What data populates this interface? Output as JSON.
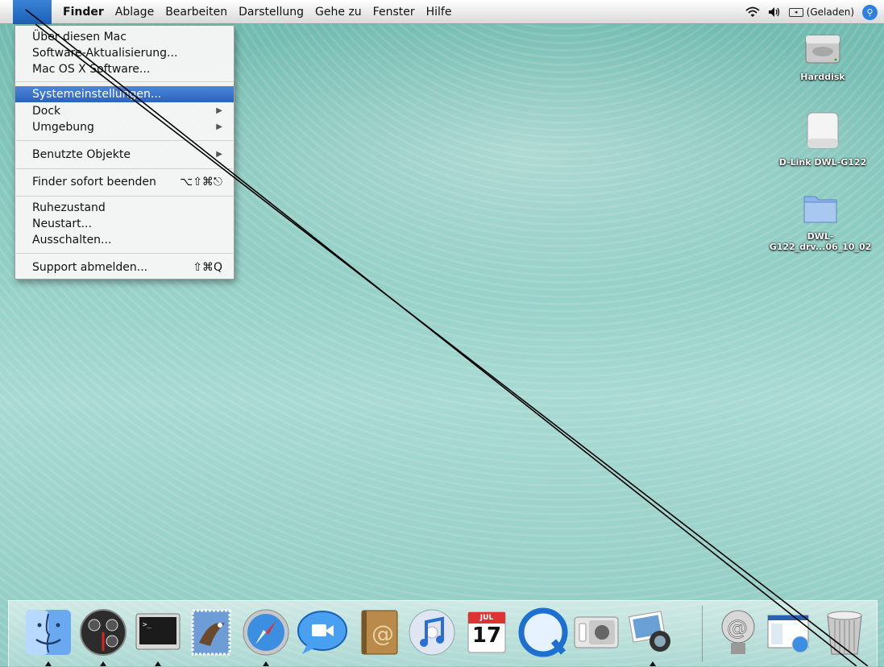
{
  "menubar": {
    "apple_glyph": "",
    "items": [
      "Finder",
      "Ablage",
      "Bearbeiten",
      "Darstellung",
      "Gehe zu",
      "Fenster",
      "Hilfe"
    ],
    "battery_label": "(Geladen)"
  },
  "apple_menu": {
    "items": [
      {
        "label": "Über diesen Mac"
      },
      {
        "label": "Software-Aktualisierung..."
      },
      {
        "label": "Mac OS X Software..."
      },
      {
        "label": "Systemeinstellungen...",
        "highlighted": true
      },
      {
        "label": "Dock",
        "submenu": true
      },
      {
        "label": "Umgebung",
        "submenu": true
      },
      {
        "label": "Benutzte Objekte",
        "submenu": true
      },
      {
        "label": "Finder sofort beenden",
        "shortcut": "⌥⇧⌘⎋"
      },
      {
        "label": "Ruhezustand"
      },
      {
        "label": "Neustart..."
      },
      {
        "label": "Ausschalten..."
      },
      {
        "label": "Support abmelden...",
        "shortcut": "⇧⌘Q"
      }
    ]
  },
  "desktop_icons": [
    {
      "label": "Harddisk",
      "icon": "hard-disk-icon"
    },
    {
      "label": "D-Link DWL-G122",
      "icon": "drive-icon"
    },
    {
      "label": "DWL-",
      "label2": "G122_drv...06_10_02",
      "icon": "folder-icon"
    }
  ],
  "dock": {
    "apps": [
      "finder-icon",
      "dashboard-icon",
      "terminal-icon",
      "mail-stamp-icon",
      "safari-icon",
      "ichat-icon",
      "address-book-icon",
      "itunes-icon",
      "ical-icon",
      "quicktime-icon",
      "system-preferences-icon",
      "iphoto-icon"
    ],
    "ical_month": "JUL",
    "ical_day": "17",
    "others": [
      "internet-connect-icon",
      "web-page-icon",
      "trash-icon"
    ]
  },
  "colors": {
    "menu_highlight": "#2a63c1",
    "desktop": "#8dccc2"
  }
}
